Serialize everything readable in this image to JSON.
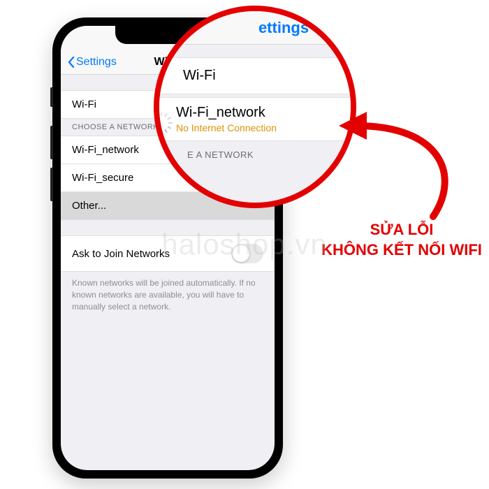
{
  "watermark": "haloshop.vn",
  "phone": {
    "back_label": "Settings",
    "title": "Wi-Fi",
    "wifi_toggle_label": "Wi-Fi",
    "choose_header": "CHOOSE A NETWORK...",
    "networks": [
      "Wi-Fi_network",
      "Wi-Fi_secure",
      "Other..."
    ],
    "ask_label": "Ask to Join Networks",
    "ask_enabled": false,
    "footer": "Known networks will be joined automatically. If no known networks are available, you will have to manually select a network."
  },
  "lens": {
    "title": "ettings",
    "wifi_label": "Wi-Fi",
    "network_name": "Wi-Fi_network",
    "status": "No Internet Connection",
    "section_partial": "E A NETWORK"
  },
  "caption": {
    "line1": "SỬA LỖI",
    "line2": "KHÔNG KẾT NỐI WIFI"
  },
  "colors": {
    "accent": "#e30000",
    "ios_blue": "#007aff",
    "warning": "#d99400"
  }
}
